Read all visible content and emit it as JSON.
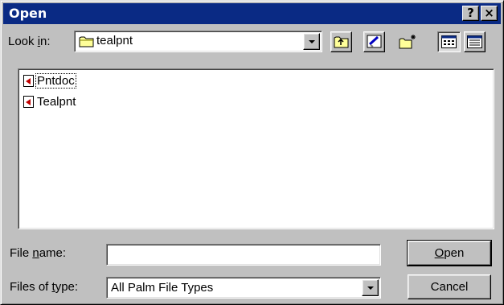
{
  "window": {
    "title": "Open",
    "help_button": "?",
    "close_button": "×"
  },
  "look_in": {
    "label_prefix": "Look ",
    "label_hotkey": "i",
    "label_suffix": "n:",
    "value": "tealpnt",
    "folder_icon": "folder-icon"
  },
  "toolbar": {
    "up_folder": "up-one-level-icon",
    "desktop": "desktop-icon",
    "new_folder": "create-new-folder-icon",
    "list_view": "list-view-icon",
    "details_view": "details-view-icon"
  },
  "files": [
    {
      "name": "Pntdoc",
      "icon": "palm-file-icon",
      "focused": true
    },
    {
      "name": "Tealpnt",
      "icon": "palm-file-icon",
      "focused": false
    }
  ],
  "file_name": {
    "label_prefix": "File ",
    "label_hotkey": "n",
    "label_suffix": "ame:",
    "value": ""
  },
  "file_type": {
    "label_prefix": "Files of ",
    "label_hotkey": "t",
    "label_suffix": "ype:",
    "value": "All Palm File Types"
  },
  "buttons": {
    "open_hotkey": "O",
    "open_rest": "pen",
    "cancel": "Cancel"
  },
  "colors": {
    "title_bar": "#0a2a84",
    "face": "#c0c0c0",
    "folder_yellow": "#ffff99",
    "palm_red": "#c00000"
  }
}
